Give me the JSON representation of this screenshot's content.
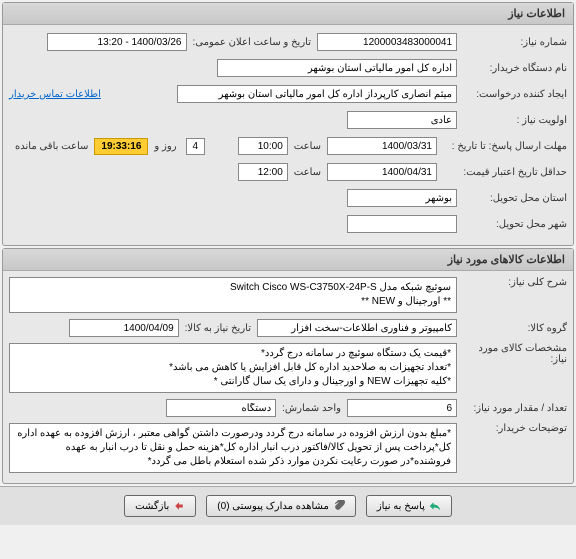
{
  "panel1": {
    "title": "اطلاعات نیاز",
    "need_number_label": "شماره نیاز:",
    "need_number": "1200003483000041",
    "announce_label": "تاریخ و ساعت اعلان عمومی:",
    "announce_value": "1400/03/26 - 13:20",
    "buyer_org_label": "نام دستگاه خریدار:",
    "buyer_org": "اداره کل امور مالیاتی استان بوشهر",
    "requester_label": "ایجاد کننده درخواست:",
    "requester": "میثم انصاری کارپرداز اداره کل امور مالیاتی استان بوشهر",
    "contact_link": "اطلاعات تماس خریدار",
    "priority_label": "اولویت نیاز :",
    "priority": "عادی",
    "deadline_label": "مهلت ارسال پاسخ:  تا تاریخ :",
    "deadline_date": "1400/03/31",
    "time_label": "ساعت",
    "deadline_time": "10:00",
    "day_label": "روز و",
    "days_remaining": "4",
    "countdown": "19:33:16",
    "remaining_label": "ساعت باقی مانده",
    "validity_label": "حداقل تاریخ اعتبار قیمت:",
    "validity_date": "1400/04/31",
    "validity_time": "12:00",
    "delivery_province_label": "استان محل تحویل:",
    "delivery_province": "بوشهر",
    "delivery_city_label": "شهر محل تحویل:",
    "delivery_city": ""
  },
  "panel2": {
    "title": "اطلاعات کالاهای مورد نیاز",
    "item_desc_label": "شرح کلی نیاز:",
    "item_desc": "سوئیچ شبکه مدل Switch Cisco WS-C3750X-24P-S\n** اورجینال و NEW **",
    "group_label": "گروه کالا:",
    "group": "کامپیوتر و فناوری اطلاعات-سخت افزار",
    "need_date_label": "تاریخ نیاز به کالا:",
    "need_date": "1400/04/09",
    "spec_label": "مشخصات کالای مورد نیاز:",
    "spec": "*قیمت یک دستگاه سوئیچ در سامانه درج گردد*\n*تعداد تجهیزات به صلاحدید اداره کل قابل افزایش یا کاهش می باشد*\n*کلیه تجهیزات NEW و اورجینال و دارای یک سال گارانتی *",
    "qty_label": "تعداد / مقدار مورد نیاز:",
    "qty": "6",
    "unit_label": "واحد شمارش:",
    "unit": "دستگاه",
    "buyer_notes_label": "توضیحات خریدار:",
    "buyer_notes": "*مبلغ بدون ارزش افزوده در سامانه درج گردد ودرصورت داشتن گواهی معتبر ، ارزش افزوده به عهده اداره کل*پرداخت پس از تحویل کالا/فاکتور درب انبار اداره کل*هزینه حمل و نقل تا درب انبار به عهده فروشنده*در صورت رعایت نکردن موارد ذکر شده استعلام باطل می گردد*"
  },
  "buttons": {
    "respond": "پاسخ به نیاز",
    "attachments": "مشاهده مدارک پیوستی (0)",
    "back": "بازگشت"
  }
}
